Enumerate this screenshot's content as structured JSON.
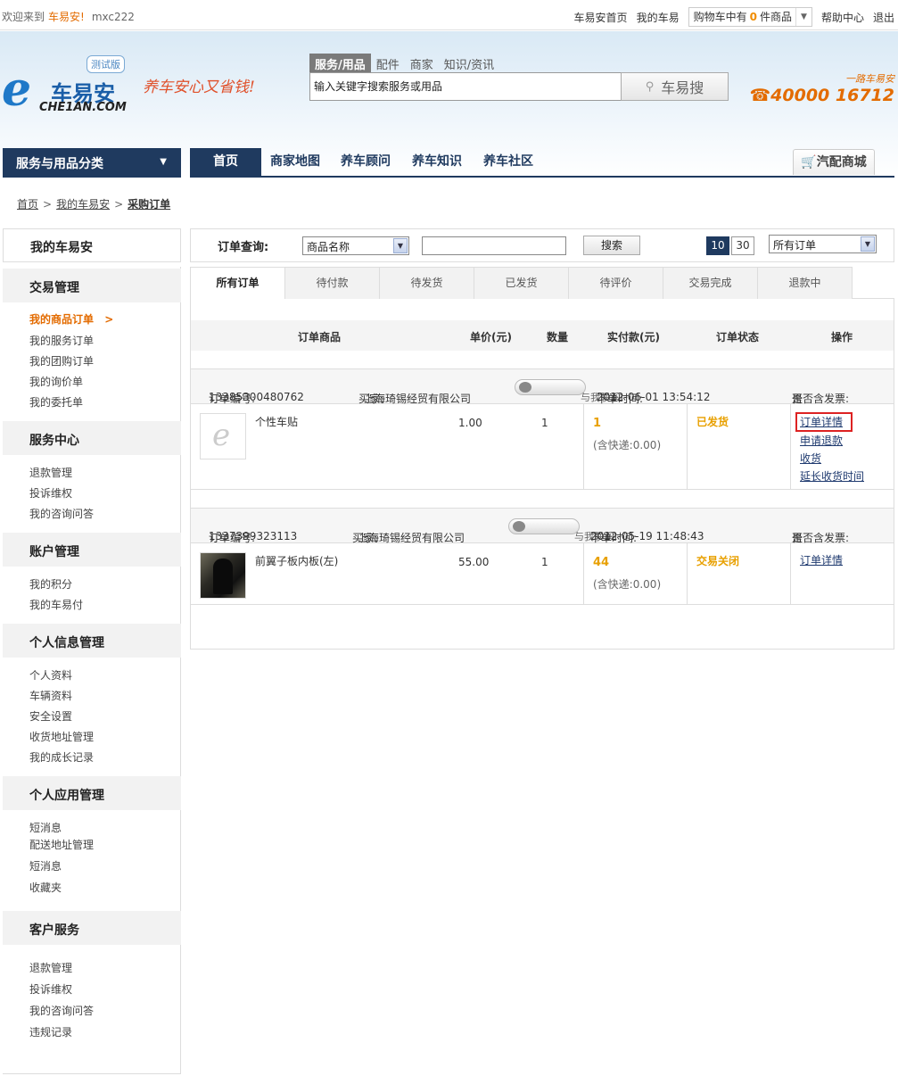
{
  "topbar": {
    "welcome": "欢迎来到",
    "brand": "车易安!",
    "username": "mxc222",
    "links": [
      "车易安首页",
      "我的车易"
    ],
    "cart_prefix": "购物车中有",
    "cart_count": "0",
    "cart_suffix": "件商品",
    "help": "帮助中心",
    "logout": "退出"
  },
  "header": {
    "logo_cn": "车易安",
    "logo_en": "CHE1AN.COM",
    "beta": "测试版",
    "slogan": "养车安心又省钱!",
    "search_tabs": [
      "服务/用品",
      "配件",
      "商家",
      "知识/资讯"
    ],
    "search_value": "输入关键字搜索服务或用品",
    "search_button": "车易搜",
    "hotline_tag": "一路车易安",
    "hotline": "40000 16712"
  },
  "nav": {
    "category": "服务与用品分类",
    "items": [
      "首页",
      "商家地图",
      "养车顾问",
      "养车知识",
      "养车社区"
    ],
    "mall": "汽配商城"
  },
  "breadcrumb": {
    "home": "首页",
    "my": "我的车易安",
    "current": "采购订单"
  },
  "sidebar": {
    "title": "我的车易安",
    "sections": [
      {
        "title": "交易管理",
        "items": [
          "我的商品订单",
          "我的服务订单",
          "我的团购订单",
          "我的询价单",
          "我的委托单"
        ]
      },
      {
        "title": "服务中心",
        "items": [
          "退款管理",
          "投诉维权",
          "我的咨询问答"
        ]
      },
      {
        "title": "账户管理",
        "items": [
          "我的积分",
          "我的车易付"
        ]
      },
      {
        "title": "个人信息管理",
        "items": [
          "个人资料",
          "车辆资料",
          "安全设置",
          "收货地址管理",
          "我的成长记录"
        ]
      },
      {
        "title": "个人应用管理",
        "items": [
          "短消息",
          "配送地址管理",
          "短消息",
          "收藏夹"
        ]
      },
      {
        "title": "客户服务",
        "items": [
          "退款管理",
          "投诉维权",
          "我的咨询问答",
          "违规记录"
        ]
      }
    ]
  },
  "query": {
    "label": "订单查询:",
    "field_select": "商品名称",
    "search_button": "搜索",
    "page_sizes": [
      "10",
      "30"
    ],
    "filter_select": "所有订单"
  },
  "tabs": [
    "所有订单",
    "待付款",
    "待发货",
    "已发货",
    "待评价",
    "交易完成",
    "退款中"
  ],
  "table": {
    "headers": [
      "订单商品",
      "单价(元)",
      "数量",
      "实付款(元)",
      "订单状态",
      "操作"
    ],
    "buyer_label": "买家:",
    "contact": "与我联系",
    "order_no_label": "订单编号:",
    "order_time_label": "下单时间:",
    "invoice_label": "是否含发票:",
    "shipping_note": "(含快递:0.00)",
    "orders": [
      {
        "order_no": "13385300480762",
        "buyer": "上海琦锡经贸有限公司",
        "time": "2012-06-01 13:54:12",
        "invoice": "否",
        "product": "个性车贴",
        "price": "1.00",
        "qty": "1",
        "paid": "1",
        "status": "已发货",
        "ops": [
          "订单详情",
          "申请退款",
          "收货",
          "延长收货时间"
        ]
      },
      {
        "order_no": "1337399323113",
        "buyer": "上海琦锡经贸有限公司",
        "time": "2012-05-19 11:48:43",
        "invoice": "否",
        "product": "前翼子板内板(左)",
        "price": "55.00",
        "qty": "1",
        "paid": "44",
        "status": "交易关闭",
        "ops": [
          "订单详情"
        ]
      }
    ]
  }
}
